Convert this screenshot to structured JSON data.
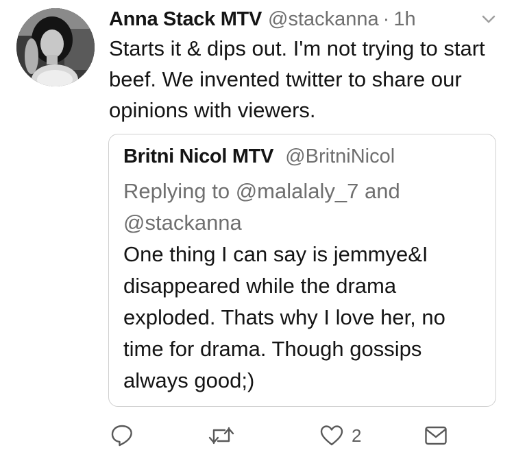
{
  "tweet": {
    "author_name": "Anna Stack MTV",
    "author_handle": "@stackanna",
    "separator": "·",
    "time": "1h",
    "text": "Starts it & dips out. I'm not trying to start beef. We invented twitter to share our opinions with viewers."
  },
  "quoted_tweet": {
    "author_name": "Britni Nicol MTV",
    "author_handle": "@BritniNicol",
    "replying_to": "Replying to @malalaly_7 and @stackanna",
    "text": "One thing I can say is jemmye&I disappeared while the drama exploded. Thats why I love her, no time for drama. Though gossips always good;)"
  },
  "actions": {
    "reply_icon": "reply-icon",
    "retweet_icon": "retweet-icon",
    "like_icon": "heart-icon",
    "like_count": "2",
    "dm_icon": "envelope-icon"
  },
  "colors": {
    "primary_text": "#141414",
    "secondary_text": "#6f6f6f",
    "border": "#cfcfcf"
  }
}
